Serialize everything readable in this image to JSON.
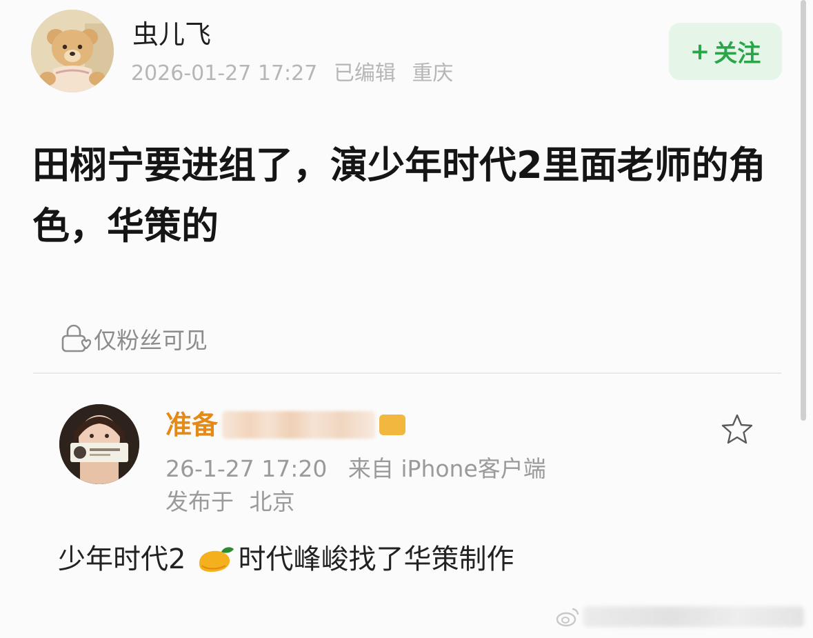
{
  "post": {
    "author": "虫儿飞",
    "date": "2026-01-27 17:27",
    "edited": "已编辑",
    "location": "重庆",
    "follow_label": "关注",
    "text": "田栩宁要进组了，演少年时代2里面老师的角色，华策的",
    "visibility": "仅粉丝可见"
  },
  "comment": {
    "name_prefix": "准备",
    "time": "26-1-27 17:20",
    "source": "来自 iPhone客户端",
    "published_label": "发布于",
    "published_location": "北京",
    "text_before": "少年时代2",
    "text_after": "时代峰峻找了华策制作"
  },
  "icons": {
    "post_avatar": "teddy-bear-avatar",
    "lock": "lock-heart-icon",
    "star": "star-icon",
    "mango": "mango-emoji",
    "watermark": "weibo-logo"
  },
  "colors": {
    "follow_green": "#2aa54a",
    "follow_bg": "#e5f6e8",
    "commenter_orange": "#e68a17"
  }
}
